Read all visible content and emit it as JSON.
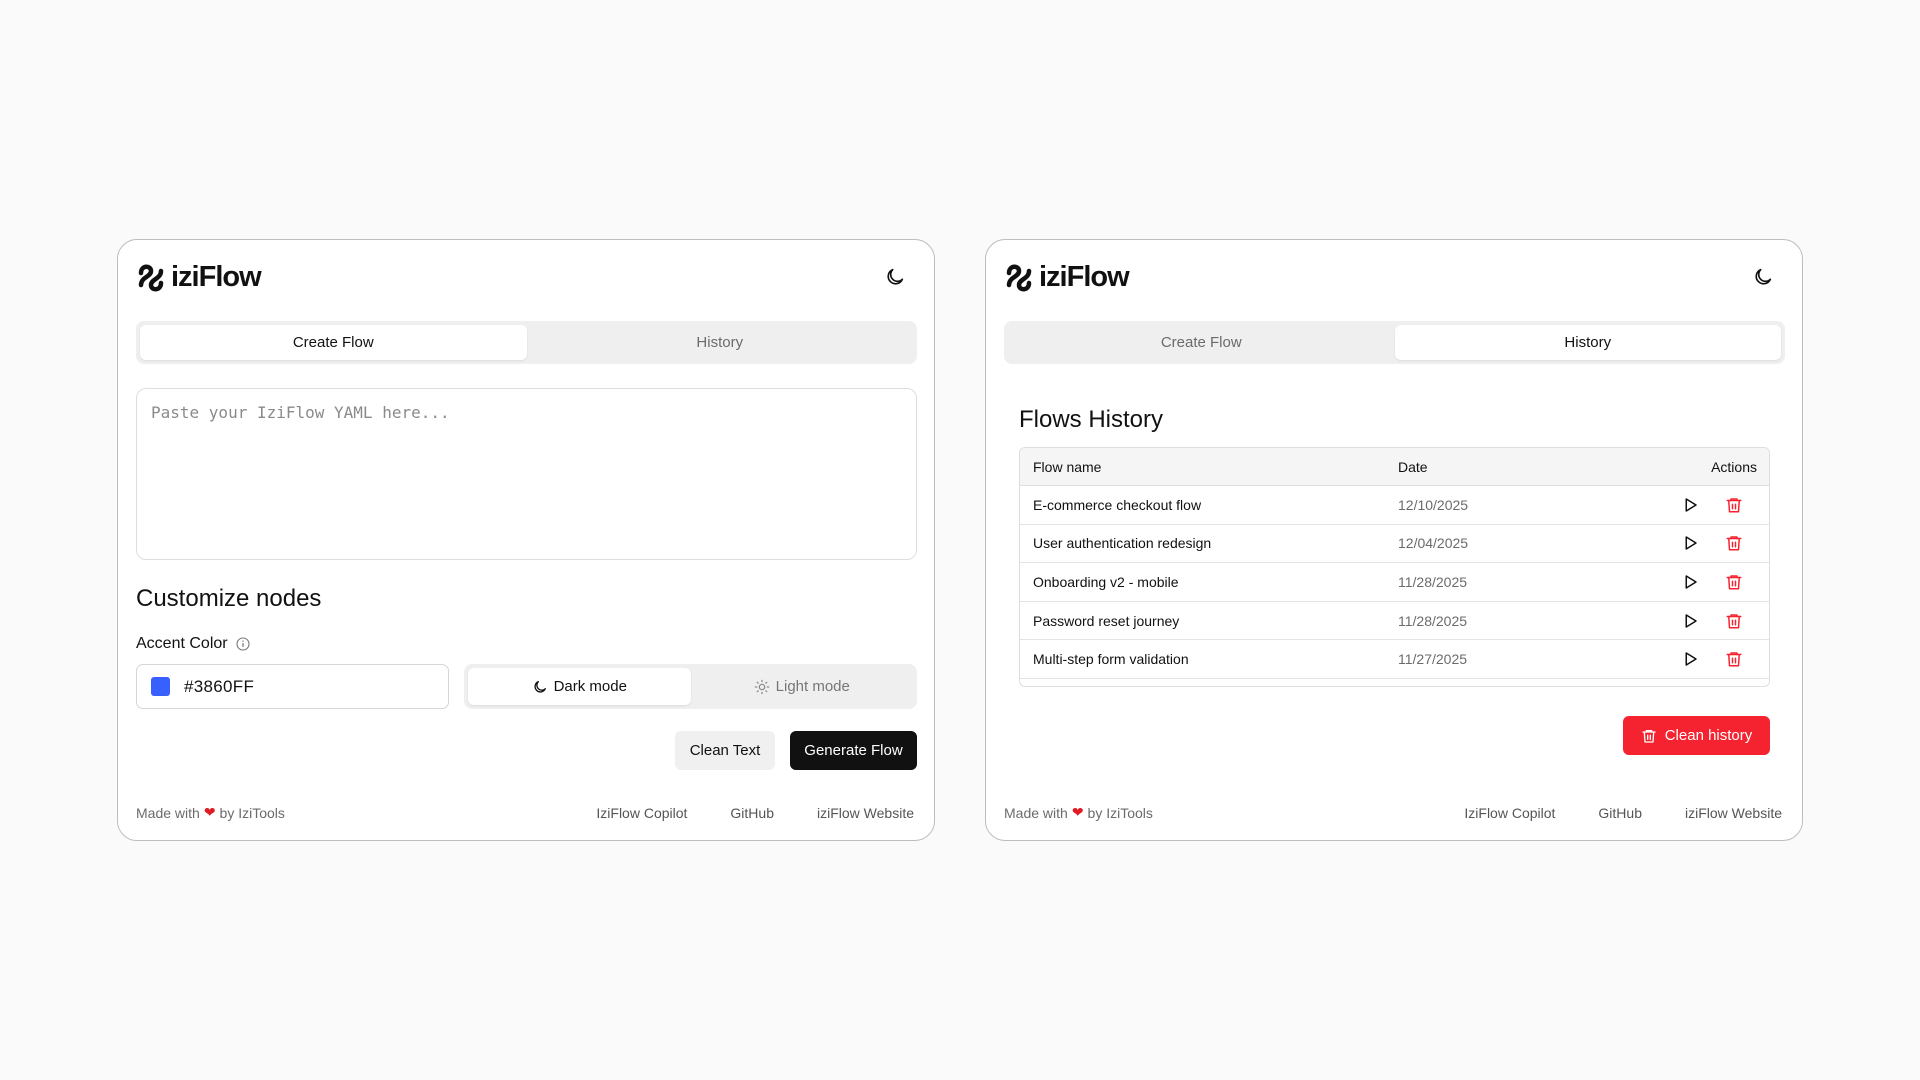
{
  "brand": {
    "name": "iziFlow"
  },
  "tabs": {
    "create": "Create Flow",
    "history": "History"
  },
  "create_panel": {
    "textarea_placeholder": "Paste your IziFlow YAML here...",
    "section_title": "Customize nodes",
    "accent_label": "Accent Color",
    "accent_value": "#3860FF",
    "accent_color": "#3860FF",
    "dark_mode": "Dark mode",
    "light_mode": "Light mode",
    "clean_text": "Clean Text",
    "generate_flow": "Generate Flow"
  },
  "history_panel": {
    "title": "Flows History",
    "columns": {
      "name": "Flow name",
      "date": "Date",
      "actions": "Actions"
    },
    "rows": [
      {
        "name": "E-commerce checkout flow",
        "date": "12/10/2025"
      },
      {
        "name": "User authentication redesign",
        "date": "12/04/2025"
      },
      {
        "name": "Onboarding v2 - mobile",
        "date": "11/28/2025"
      },
      {
        "name": "Password reset journey",
        "date": "11/28/2025"
      },
      {
        "name": "Multi-step form validation",
        "date": "11/27/2025"
      }
    ],
    "clean_history": "Clean history"
  },
  "footer": {
    "made_with": "Made with",
    "by": "by IziTools",
    "links": [
      "IziFlow Copilot",
      "GitHub",
      "iziFlow Website"
    ]
  },
  "colors": {
    "danger": "#F5232F",
    "primary": "#111111",
    "heart": "#E01B24"
  }
}
